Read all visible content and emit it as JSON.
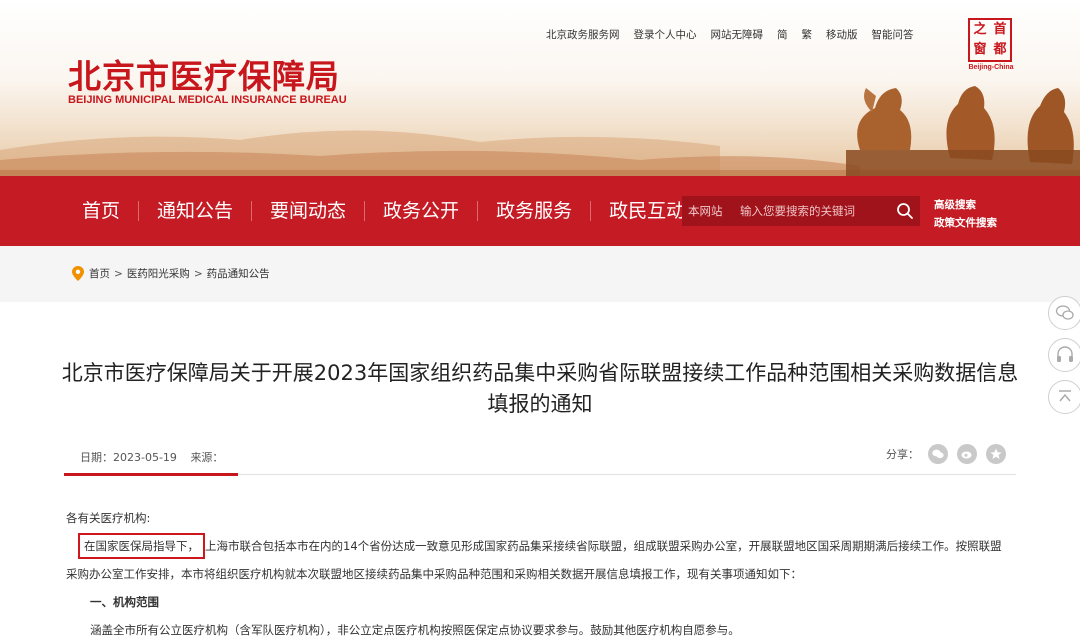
{
  "header": {
    "logo_cn": "北京市医疗保障局",
    "logo_en": "BEIJING MUNICIPAL MEDICAL INSURANCE BUREAU",
    "top_links": [
      "北京政务服务网",
      "登录个人中心",
      "网站无障碍",
      "简",
      "繁",
      "移动版",
      "智能问答"
    ],
    "seal": {
      "chars": [
        "之",
        "首",
        "窗",
        "都"
      ],
      "en": "Beijing-China"
    }
  },
  "nav": {
    "items": [
      "首页",
      "通知公告",
      "要闻动态",
      "政务公开",
      "政务服务",
      "政民互动"
    ],
    "search": {
      "scope": "本网站",
      "placeholder": "输入您要搜索的关键词"
    },
    "advanced": [
      "高级搜索",
      "政策文件搜索"
    ]
  },
  "breadcrumb": [
    "首页",
    "医药阳光采购",
    "药品通知公告"
  ],
  "article": {
    "title": "北京市医疗保障局关于开展2023年国家组织药品集中采购省际联盟接续工作品种范围相关采购数据信息填报的通知",
    "date": "日期：2023-05-19",
    "source": "来源：",
    "share_label": "分享：",
    "salutation": "各有关医疗机构:",
    "highlight": "在国家医保局指导下，",
    "para1_rest": "上海市联合包括本市在内的14个省份达成一致意见形成国家药品集采接续省际联盟，组成联盟采购办公室，开展联盟地区国采周期期满后接续工作。按照联盟采购办公室工作安排，本市将组织医疗机构就本次联盟地区接续药品集中采购品种范围和采购相关数据开展信息填报工作，现有关事项通知如下：",
    "section1": "一、机构范围",
    "para2": "涵盖全市所有公立医疗机构（含军队医疗机构），非公立定点医疗机构按照医保定点协议要求参与。鼓励其他医疗机构自愿参与。"
  },
  "colors": {
    "brand_red": "#c41b24",
    "accent_red": "#c8161d"
  },
  "icons": [
    "location-pin-icon",
    "search-icon",
    "wechat-icon",
    "weibo-icon",
    "star-icon",
    "chat-icon",
    "headset-icon",
    "back-to-top-icon"
  ]
}
